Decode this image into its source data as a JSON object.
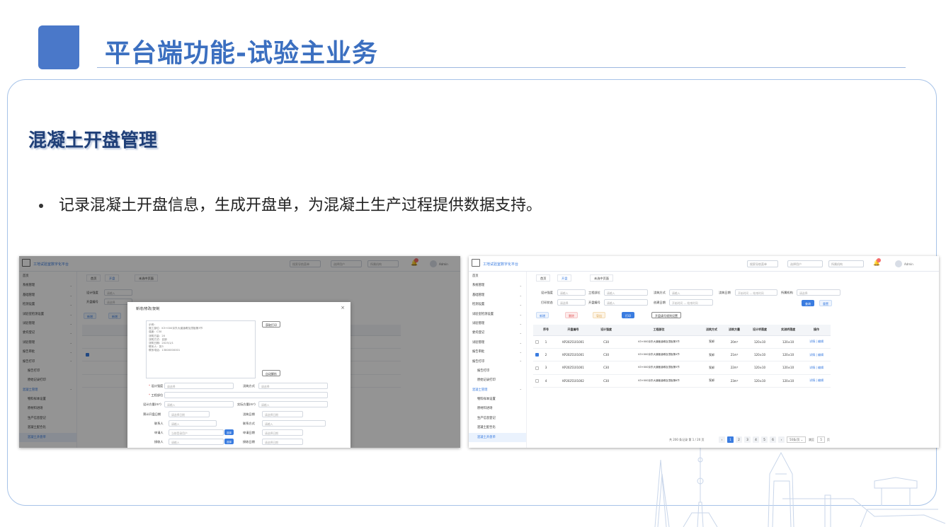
{
  "slide": {
    "title": "平台端功能-试验主业务",
    "subtitle": "混凝土开盘管理",
    "bullet": "记录混凝土开盘信息，生成开盘单，为混凝土生产过程提供数据支持。"
  },
  "app": {
    "system_name": "工地试验室数字化平台",
    "search_placeholder": "搜索导航菜单",
    "user_select": "选择用户",
    "org_select": "所属机构",
    "admin_label": "Admin",
    "notification_count": "5"
  },
  "sidebar": {
    "items": [
      {
        "label": "首页",
        "arrow": ""
      },
      {
        "label": "系统管理",
        "arrow": "⌄"
      },
      {
        "label": "基础管理",
        "arrow": "⌄"
      },
      {
        "label": "检测设置",
        "arrow": "⌄"
      },
      {
        "label": "试验室检测设置",
        "arrow": "⌄"
      },
      {
        "label": "试验管理",
        "arrow": "⌄"
      },
      {
        "label": "委托登记",
        "arrow": "⌄"
      },
      {
        "label": "试验管理",
        "arrow": "⌄"
      },
      {
        "label": "报告审批",
        "arrow": "⌄"
      },
      {
        "label": "报告打印",
        "arrow": "⌃"
      },
      {
        "label": "报告打印",
        "arrow": ""
      },
      {
        "label": "原始记录打印",
        "arrow": ""
      },
      {
        "label": "混凝土管理",
        "arrow": "⌃"
      },
      {
        "label": "物料样本设置",
        "arrow": ""
      },
      {
        "label": "原材料进场",
        "arrow": ""
      },
      {
        "label": "生产信息登记",
        "arrow": ""
      },
      {
        "label": "混凝土配合比",
        "arrow": ""
      },
      {
        "label": "混凝土开盘单",
        "arrow": ""
      }
    ]
  },
  "tabs": {
    "home": "首页",
    "current": "开盘",
    "close": "×",
    "other": "未选中页面"
  },
  "filters": {
    "design_grade": "设计强度",
    "project_part": "工程部位",
    "pour_method": "浇筑方式",
    "pour_date": "浇筑日期",
    "org": "所属机构",
    "print_status": "打印状态",
    "open_no": "开盘编号",
    "create_date": "创建日期",
    "input_placeholder": "请输入",
    "select_placeholder": "请选择",
    "date_range": "开始时间 — 结束时间"
  },
  "buttons": {
    "search": "查询",
    "reset": "重置",
    "add": "新增",
    "delete": "删除",
    "export": "导出",
    "print": "打印",
    "print_setting": "开盘请号规则设置",
    "get_print": "获取打印",
    "auto_parse": "自动解析",
    "select": "选择"
  },
  "table": {
    "headers": [
      "序号",
      "开盘编号",
      "设计强度",
      "工程部位",
      "浇筑方式",
      "浇筑方量",
      "设计坍落度",
      "实测坍落度",
      "操作"
    ],
    "rows": [
      {
        "no": "1",
        "code": "KP2025101001",
        "grade": "C30",
        "part": "K3+000京东大道截涵墩及顶板第3节",
        "method": "泵卸",
        "volume": "20m³",
        "slump": "120±10",
        "real": "120±10",
        "checked": false
      },
      {
        "no": "2",
        "code": "KP2025101001",
        "grade": "C30",
        "part": "K3+000京东大道截涵墩及顶板第4节",
        "method": "泵卸",
        "volume": "21m³",
        "slump": "120±10",
        "real": "120±10",
        "checked": true
      },
      {
        "no": "3",
        "code": "KP2025101001",
        "grade": "C30",
        "part": "K3+000京东大道截涵墩及顶板第5节",
        "method": "泵卸",
        "volume": "22m³",
        "slump": "120±10",
        "real": "120±10",
        "checked": false
      },
      {
        "no": "4",
        "code": "KP2025101002",
        "grade": "C30",
        "part": "K3+000京东大道截涵墩及顶板第6节",
        "method": "泵卸",
        "volume": "23m³",
        "slump": "120±10",
        "real": "120±10",
        "checked": false
      }
    ],
    "actions": "详情 | 编辑"
  },
  "pager": {
    "summary": "共 200 条记录 第 1 / 20 页",
    "pages": [
      "1",
      "2",
      "3",
      "4",
      "5",
      "6"
    ],
    "page_size": "50条/页",
    "jump_label": "跳至",
    "jump_value": "5",
    "page_suffix": "页"
  },
  "dialog": {
    "title": "新增/修改/复制",
    "close": "×",
    "text_sample": "示例：\n施工部位：K3+000京东大道涵墩及顶板第3节\n强度：C30\n浇筑方量：20\n浇筑方式：自卸\n浇筑日期：2025/1/1\n联系人：张3\n联系电话：13800000001",
    "fields": {
      "design_grade": "设计强度",
      "pour_method": "浇筑方式",
      "project_part": "工程部位",
      "design_volume": "设计方量(m³)",
      "actual_volume": "实际方量(m³)",
      "plan_date": "预计开盘日期",
      "pour_date": "浇筑日期",
      "contact": "联系人",
      "contact_method": "联系方式",
      "applicant": "申请人",
      "apply_date": "申请日期",
      "receiver": "接收人",
      "receive_date": "接收日期",
      "date_placeholder": "请选择日期",
      "applicant_value": "当前登录用户"
    }
  }
}
